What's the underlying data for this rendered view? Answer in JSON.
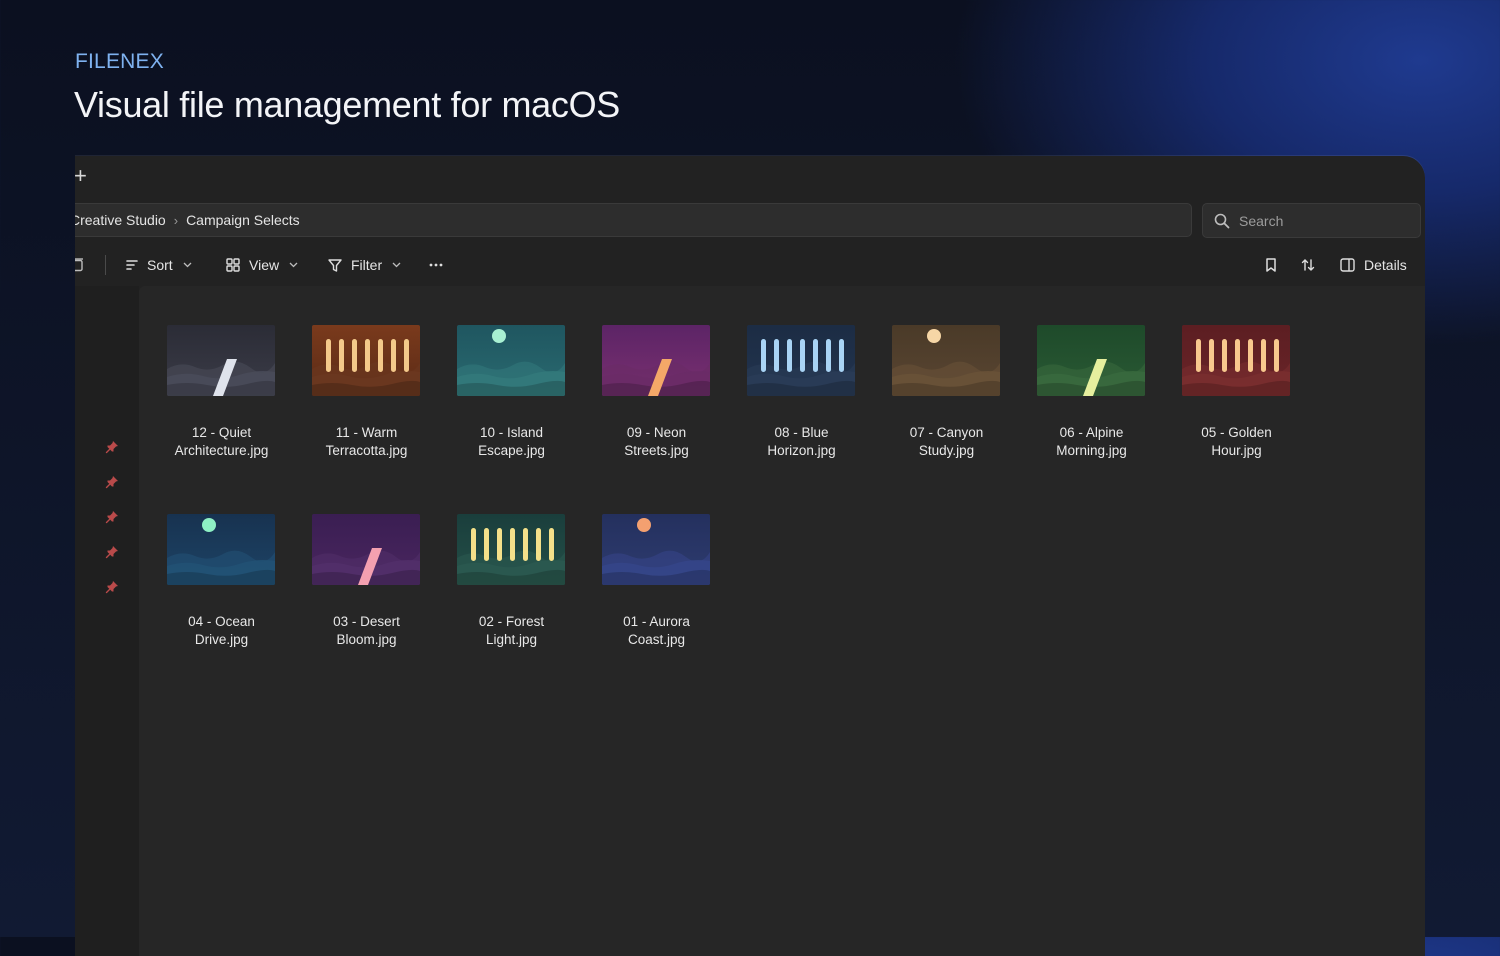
{
  "brand": {
    "eyebrow": "FILENEX",
    "headline": "Visual file management for macOS"
  },
  "tabbar": {
    "new_tab_label": "+"
  },
  "breadcrumb": {
    "items": [
      "Creative Studio",
      "Campaign Selects"
    ],
    "separator": "›"
  },
  "search": {
    "placeholder": "Search"
  },
  "toolbar": {
    "sort_label": "Sort",
    "view_label": "View",
    "filter_label": "Filter",
    "details_label": "Details"
  },
  "sidebar": {
    "pinned_count": 5,
    "pin_color": "#b94a4a"
  },
  "files": [
    {
      "name_line1": "12 - Quiet",
      "name_line2": "Architecture.jpg",
      "art": "road",
      "bg": [
        "#2b2c36",
        "#3b3c48"
      ],
      "hill": "#4a4c5a",
      "accent": "#dfe3ec"
    },
    {
      "name_line1": "11 - Warm",
      "name_line2": "Terracotta.jpg",
      "art": "bars",
      "bg": [
        "#7a3a1c",
        "#5a2a16"
      ],
      "hill": "#6b3820",
      "accent": "#f4c98a"
    },
    {
      "name_line1": "10 - Island",
      "name_line2": "Escape.jpg",
      "art": "sun",
      "bg": [
        "#1f5660",
        "#2a6a70"
      ],
      "hill": "#337a7c",
      "accent": "#a8f0d2"
    },
    {
      "name_line1": "09 - Neon",
      "name_line2": "Streets.jpg",
      "art": "road",
      "bg": [
        "#5c2466",
        "#7a3070"
      ],
      "hill": "#6a2c66",
      "accent": "#f4a868"
    },
    {
      "name_line1": "08 - Blue",
      "name_line2": "Horizon.jpg",
      "art": "bars",
      "bg": [
        "#1c2c44",
        "#22344e"
      ],
      "hill": "#2a3c58",
      "accent": "#a9d4f5"
    },
    {
      "name_line1": "07 - Canyon",
      "name_line2": "Study.jpg",
      "art": "sun",
      "bg": [
        "#4a3a28",
        "#5a4632"
      ],
      "hill": "#6a5238",
      "accent": "#f6d6a6"
    },
    {
      "name_line1": "06 - Alpine",
      "name_line2": "Morning.jpg",
      "art": "road",
      "bg": [
        "#1e4a2a",
        "#2a5a34"
      ],
      "hill": "#3a6a3e",
      "accent": "#e6ef9e"
    },
    {
      "name_line1": "05 - Golden",
      "name_line2": "Hour.jpg",
      "art": "bars",
      "bg": [
        "#5c1e22",
        "#6a2428"
      ],
      "hill": "#7a2e30",
      "accent": "#f8c88e"
    },
    {
      "name_line1": "04 - Ocean",
      "name_line2": "Drive.jpg",
      "art": "sun",
      "bg": [
        "#173250",
        "#1e4466"
      ],
      "hill": "#225276",
      "accent": "#8ef0c4"
    },
    {
      "name_line1": "03 - Desert",
      "name_line2": "Bloom.jpg",
      "art": "road",
      "bg": [
        "#3a1e52",
        "#4a2660"
      ],
      "hill": "#52306a",
      "accent": "#f4a0b0"
    },
    {
      "name_line1": "02 - Forest",
      "name_line2": "Light.jpg",
      "art": "bars",
      "bg": [
        "#1a3e3c",
        "#245048"
      ],
      "hill": "#2c5a50",
      "accent": "#f4e08a"
    },
    {
      "name_line1": "01 - Aurora",
      "name_line2": "Coast.jpg",
      "art": "sun",
      "bg": [
        "#24305e",
        "#2e3c70"
      ],
      "hill": "#36468a",
      "accent": "#f4a070"
    }
  ]
}
